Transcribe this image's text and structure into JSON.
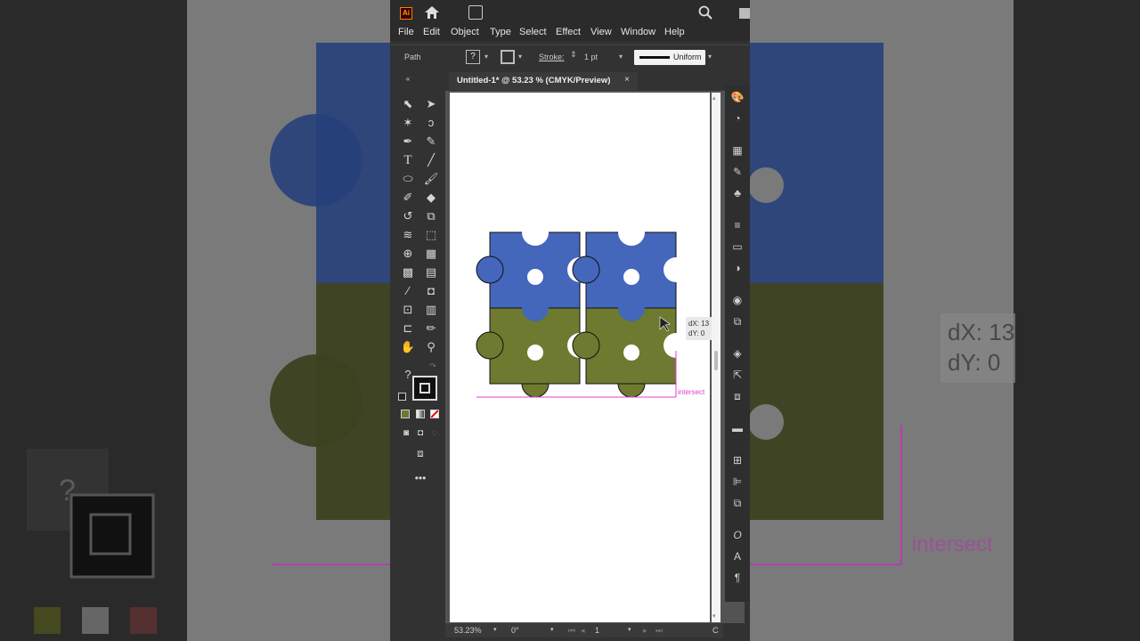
{
  "app": {
    "logo_text": "Ai",
    "menu": [
      "File",
      "Edit",
      "Object",
      "Type",
      "Select",
      "Effect",
      "View",
      "Window",
      "Help"
    ],
    "control_bar": {
      "selection_label": "Path",
      "fill_value": "?",
      "stroke_label": "Stroke:",
      "stroke_weight": "1 pt",
      "profile": "Uniform"
    },
    "document_tab": {
      "title": "Untitled-1* @ 53.23 % (CMYK/Preview)",
      "close_glyph": "×"
    },
    "status_bar": {
      "zoom": "53.23%",
      "rotation": "0°",
      "artboard_index": "1",
      "tail": "C"
    },
    "canvas_overlay": {
      "dx": "dX: 13",
      "dy": "dY: 0",
      "smart_guide": "intersect"
    },
    "swatches": {
      "fill_unknown": "?",
      "colors": {
        "blue": "#4466bb",
        "olive": "#6e7a30",
        "guide": "#e23cdc",
        "accent": "#ff7c00"
      }
    }
  },
  "background": {
    "dx_label": "dX: 13",
    "dy_label": "dY: 0",
    "intersect_label": "intersect",
    "question": "?"
  }
}
